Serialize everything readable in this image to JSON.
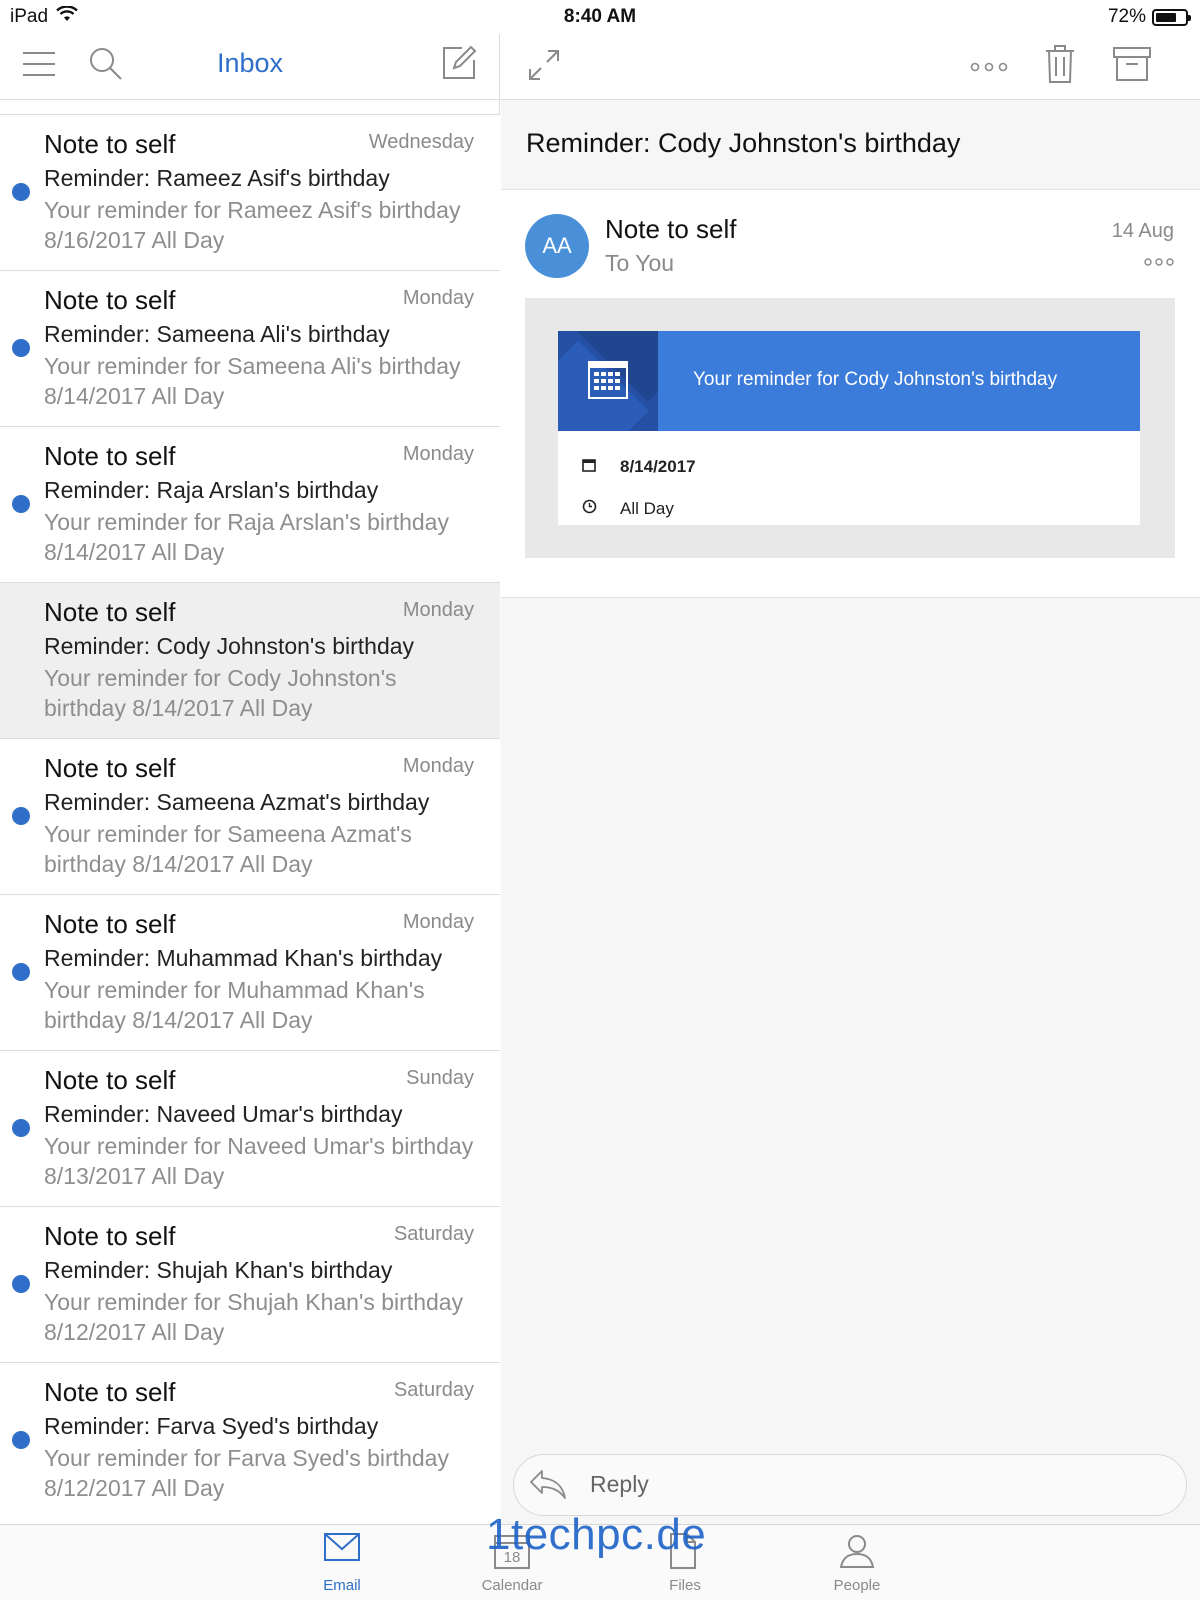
{
  "status_bar": {
    "device": "iPad",
    "time": "8:40 AM",
    "battery": "72%",
    "battery_level": 0.72
  },
  "list_toolbar": {
    "title": "Inbox",
    "icons": [
      "hamburger-menu-icon",
      "search-icon",
      "compose-icon"
    ]
  },
  "messages": [
    {
      "sender": "Note to self",
      "date": "Wednesday",
      "subject": "Reminder: Rameez Asif's birthday",
      "preview": "Your reminder for Rameez Asif's birthday 8/16/2017 All Day",
      "unread": true,
      "selected": false
    },
    {
      "sender": "Note to self",
      "date": "Monday",
      "subject": "Reminder: Sameena Ali's birthday",
      "preview": "Your reminder for Sameena Ali's birthday 8/14/2017 All Day",
      "unread": true,
      "selected": false
    },
    {
      "sender": "Note to self",
      "date": "Monday",
      "subject": "Reminder: Raja Arslan's birthday",
      "preview": "Your reminder for Raja Arslan's birthday 8/14/2017 All Day",
      "unread": true,
      "selected": false
    },
    {
      "sender": "Note to self",
      "date": "Monday",
      "subject": "Reminder: Cody Johnston's birthday",
      "preview": "Your reminder for Cody Johnston's birthday 8/14/2017 All Day",
      "unread": false,
      "selected": true
    },
    {
      "sender": "Note to self",
      "date": "Monday",
      "subject": "Reminder: Sameena Azmat's birthday",
      "preview": "Your reminder for Sameena Azmat's birthday 8/14/2017 All Day",
      "unread": true,
      "selected": false
    },
    {
      "sender": "Note to self",
      "date": "Monday",
      "subject": "Reminder: Muhammad Khan's birthday",
      "preview": "Your reminder for Muhammad Khan's birthday 8/14/2017 All Day",
      "unread": true,
      "selected": false
    },
    {
      "sender": "Note to self",
      "date": "Sunday",
      "subject": "Reminder: Naveed Umar's birthday",
      "preview": "Your reminder for Naveed Umar's birthday 8/13/2017 All Day",
      "unread": true,
      "selected": false
    },
    {
      "sender": "Note to self",
      "date": "Saturday",
      "subject": "Reminder: Shujah Khan's birthday",
      "preview": "Your reminder for Shujah Khan's birthday 8/12/2017 All Day",
      "unread": true,
      "selected": false
    },
    {
      "sender": "Note to self",
      "date": "Saturday",
      "subject": "Reminder: Farva Syed's birthday",
      "preview": "Your reminder for Farva Syed's birthday 8/12/2017 All Day",
      "unread": true,
      "selected": false
    }
  ],
  "detail_toolbar": {
    "icons": [
      "expand-icon",
      "more-options-icon",
      "delete-icon",
      "archive-icon"
    ]
  },
  "detail": {
    "subject": "Reminder: Cody Johnston's birthday",
    "avatar_initials": "AA",
    "from": "Note to self",
    "to": "To You",
    "date": "14 Aug",
    "reminder": {
      "banner_text": "Your reminder for Cody Johnston's birthday",
      "event_date": "8/14/2017",
      "event_time": "All Day"
    }
  },
  "reply": {
    "label": "Reply"
  },
  "tabs": [
    {
      "label": "Email",
      "icon": "mail-icon",
      "active": true
    },
    {
      "label": "Calendar",
      "icon": "calendar-icon",
      "day": "18",
      "active": false
    },
    {
      "label": "Files",
      "icon": "files-icon",
      "active": false
    },
    {
      "label": "People",
      "icon": "people-icon",
      "active": false
    }
  ],
  "watermark": "1techpc.de",
  "colors": {
    "accent": "#2f6fc9",
    "banner": "#3b7bd9",
    "avatar": "#4a90d9",
    "unread_dot": "#2f6fc9"
  }
}
